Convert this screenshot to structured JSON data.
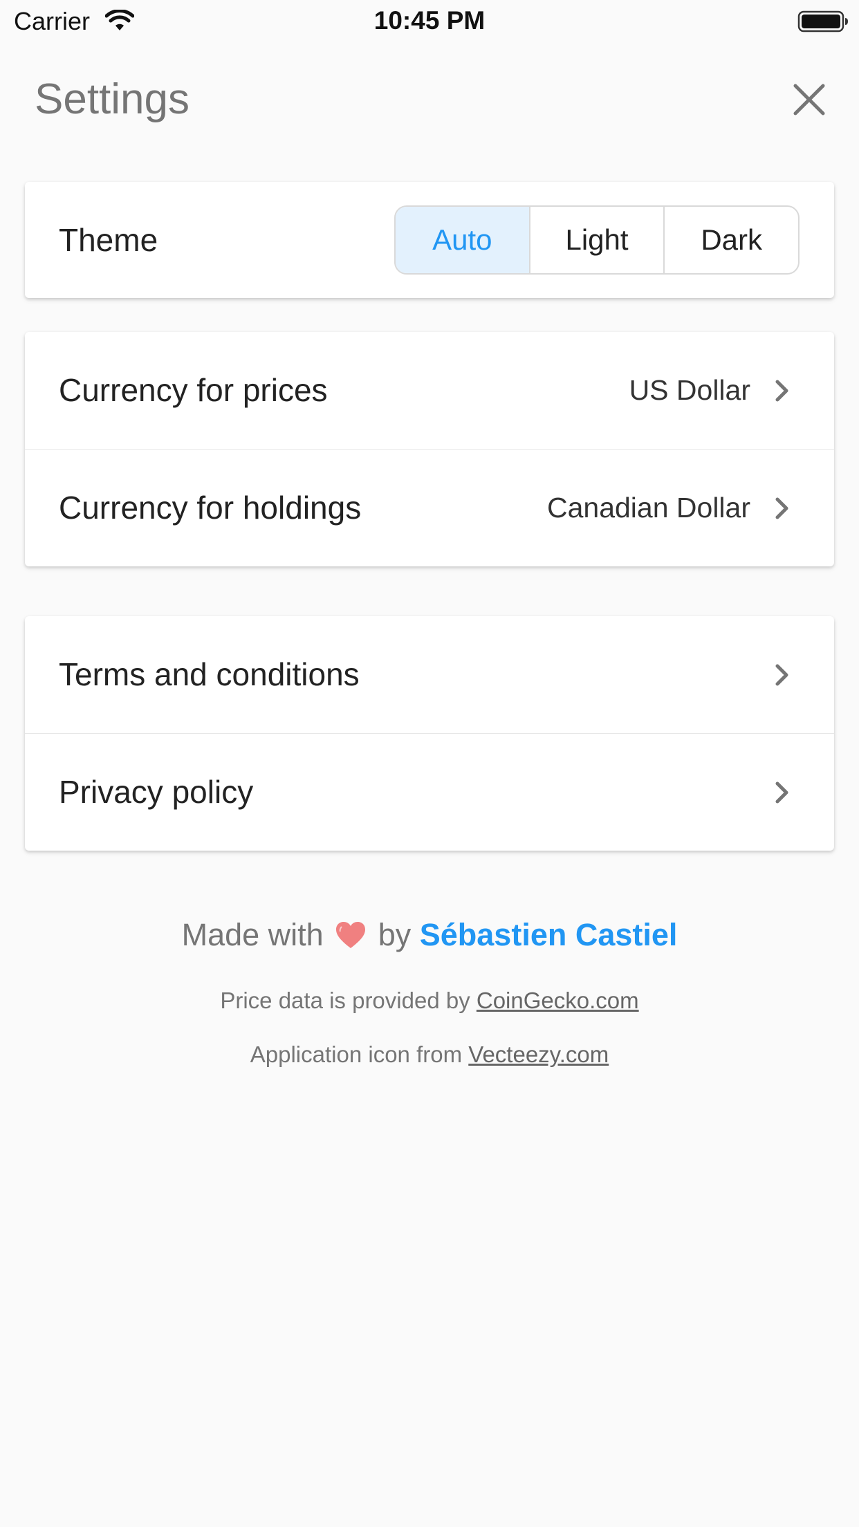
{
  "status_bar": {
    "carrier": "Carrier",
    "time": "10:45 PM"
  },
  "header": {
    "title": "Settings",
    "close_icon": "close-icon"
  },
  "theme": {
    "label": "Theme",
    "options": [
      "Auto",
      "Light",
      "Dark"
    ],
    "selected": "Auto"
  },
  "currency": {
    "prices_label": "Currency for prices",
    "prices_value": "US Dollar",
    "holdings_label": "Currency for holdings",
    "holdings_value": "Canadian Dollar"
  },
  "legal": {
    "terms_label": "Terms and conditions",
    "privacy_label": "Privacy policy"
  },
  "footer": {
    "made_with": "Made with",
    "by": "by",
    "author": "Sébastien Castiel",
    "price_data_prefix": "Price data is provided by",
    "price_data_link": "CoinGecko.com",
    "icon_prefix": "Application icon from",
    "icon_link": "Vecteezy.com"
  },
  "colors": {
    "accent": "#2196f3",
    "selected_segment_bg": "#e3f1fd",
    "heart": "#f08080",
    "background": "#fafafa"
  }
}
